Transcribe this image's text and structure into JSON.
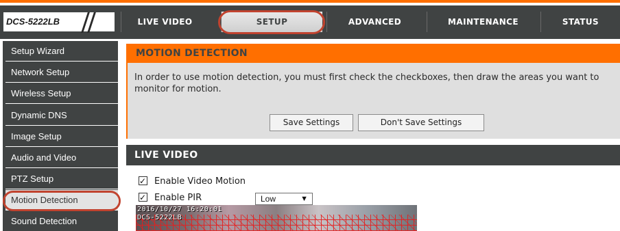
{
  "header": {
    "model": "DCS-5222LB",
    "tabs": [
      {
        "label": "LIVE VIDEO"
      },
      {
        "label": "SETUP"
      },
      {
        "label": "ADVANCED"
      },
      {
        "label": "MAINTENANCE"
      },
      {
        "label": "STATUS"
      }
    ],
    "active_tab": "SETUP"
  },
  "sidebar": {
    "items": [
      {
        "label": "Setup Wizard"
      },
      {
        "label": "Network Setup"
      },
      {
        "label": "Wireless Setup"
      },
      {
        "label": "Dynamic DNS"
      },
      {
        "label": "Image Setup"
      },
      {
        "label": "Audio and Video"
      },
      {
        "label": "PTZ Setup"
      },
      {
        "label": "Motion Detection"
      },
      {
        "label": "Sound Detection"
      }
    ],
    "active_item": "Motion Detection"
  },
  "motion_detection": {
    "title": "MOTION DETECTION",
    "description": "In order to use motion detection, you must first check the checkboxes, then draw the areas you want to monitor for motion.",
    "save_label": "Save Settings",
    "dont_save_label": "Don't Save Settings"
  },
  "live_video": {
    "title": "LIVE VIDEO",
    "enable_video_motion": {
      "label": "Enable Video Motion",
      "checked": true
    },
    "enable_pir": {
      "label": "Enable PIR",
      "checked": true
    },
    "pir_level": {
      "selected": "Low"
    },
    "osd_timestamp": "2016/10/27 16:20:01",
    "osd_model": "DCS-5222LB"
  },
  "colors": {
    "accent": "#ff6f00",
    "dark": "#404343",
    "highlight_ring": "#c1432f",
    "panel": "#dfdfdf",
    "motion_grid": "#e61e1e"
  }
}
